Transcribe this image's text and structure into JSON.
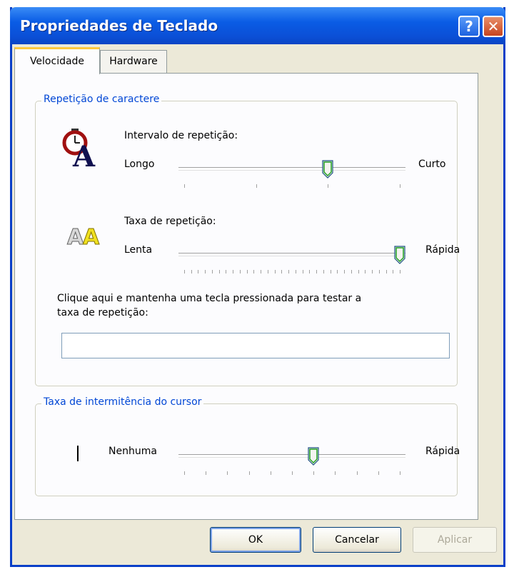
{
  "window": {
    "title": "Propriedades de Teclado",
    "help_icon": "?",
    "close_icon": "✕"
  },
  "tabs": [
    {
      "label": "Velocidade",
      "active": true
    },
    {
      "label": "Hardware",
      "active": false
    }
  ],
  "repeat_group": {
    "legend": "Repetição de caractere",
    "delay": {
      "title": "Intervalo de repetição:",
      "left_label": "Longo",
      "right_label": "Curto",
      "icon": "stopwatch-a-icon",
      "value": 2,
      "max": 3
    },
    "rate": {
      "title": "Taxa de repetição:",
      "left_label": "Lenta",
      "right_label": "Rápida",
      "icon": "double-a-icon",
      "value": 31,
      "max": 31
    },
    "test_prompt_line1": "Clique aqui e mantenha uma tecla pressionada para testar a",
    "test_prompt_line2": "taxa de repetição:",
    "test_value": ""
  },
  "cursor_group": {
    "legend": "Taxa de intermitência do cursor",
    "left_label": "Nenhuma",
    "right_label": "Rápida",
    "value": 6,
    "max": 10
  },
  "buttons": {
    "ok": "OK",
    "cancel": "Cancelar",
    "apply": "Aplicar"
  },
  "colors": {
    "title_bar": "#0a5ce5",
    "legend_text": "#0046d5",
    "tab_highlight": "#ffc83c"
  }
}
